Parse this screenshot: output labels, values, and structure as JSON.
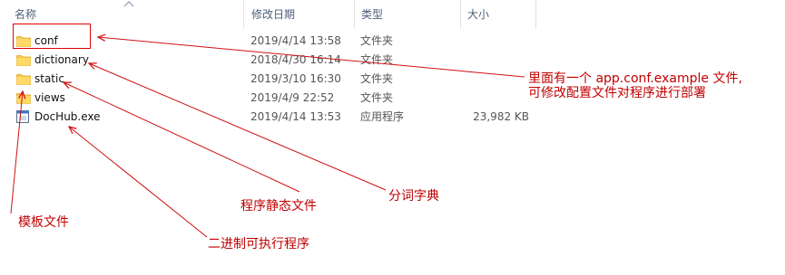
{
  "columns": {
    "name": "名称",
    "date": "修改日期",
    "type": "类型",
    "size": "大小"
  },
  "files": [
    {
      "name": "conf",
      "date": "2019/4/14 13:58",
      "type": "文件夹",
      "size": "",
      "icon": "folder-icon"
    },
    {
      "name": "dictionary",
      "date": "2018/4/30 16:14",
      "type": "文件夹",
      "size": "",
      "icon": "folder-icon"
    },
    {
      "name": "static",
      "date": "2019/3/10 16:30",
      "type": "文件夹",
      "size": "",
      "icon": "folder-icon"
    },
    {
      "name": "views",
      "date": "2019/4/9 22:52",
      "type": "文件夹",
      "size": "",
      "icon": "folder-icon"
    },
    {
      "name": "DocHub.exe",
      "date": "2019/4/14 13:53",
      "type": "应用程序",
      "size": "23,982 KB",
      "icon": "application-icon"
    }
  ],
  "annotations": {
    "conf_line1": "里面有一个 app.conf.example 文件,",
    "conf_line2": "可修改配置文件对程序进行部署",
    "dictionary": "分词字典",
    "static": "程序静态文件",
    "views": "模板文件",
    "exe": "二进制可执行程序"
  },
  "colors": {
    "annotation": "#c00000",
    "header_text": "#4c607a",
    "folder": "#f5c94c"
  }
}
